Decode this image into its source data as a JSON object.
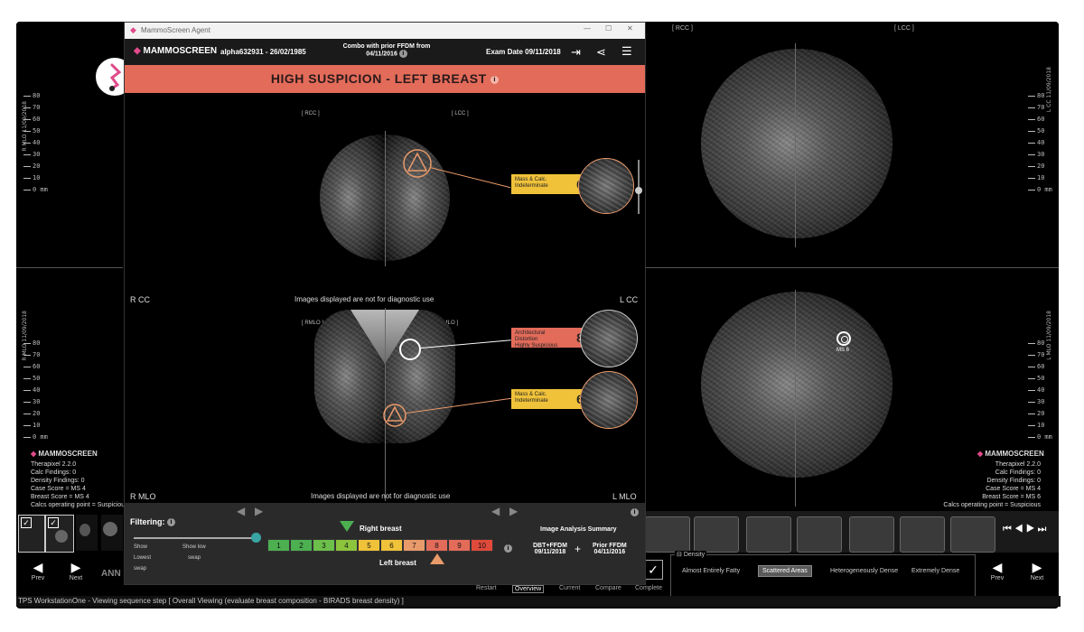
{
  "agent": {
    "window_title": "MammoScreen Agent",
    "logo": "MAMMOSCREEN",
    "patient": "alpha632931 - 26/02/1985",
    "combo_line1": "Combo with prior FFDM from",
    "combo_line2": "04/11/2016",
    "exam_date": "Exam Date 09/11/2018",
    "alert": "HIGH SUSPICION - LEFT BREAST",
    "view_rcc": "R CC",
    "view_lcc": "L CC",
    "view_rmlo": "R MLO",
    "view_lmlo": "L MLO",
    "not_diag_top": "Images displayed are not for diagnostic use",
    "not_diag_bottom": "Images displayed are not for diagnostic use",
    "findings": [
      {
        "label1": "Mass & Calc.",
        "label2": "Indeterminate",
        "score": "6",
        "color": "#f0c23a"
      },
      {
        "label1": "Architectural Distortion",
        "label2": "Highly Suspicious",
        "score": "8",
        "color": "#e36b5a"
      },
      {
        "label1": "Mass & Calc.",
        "label2": "Indeterminate",
        "score": "6",
        "color": "#f0c23a"
      }
    ]
  },
  "bottom": {
    "filtering": "Filtering:",
    "filter_show": "Show",
    "filter_show_low": "Show low",
    "filter_lowest": "Lowest",
    "filter_swap": "swap",
    "filter_swap2": "swap",
    "right_breast": "Right breast",
    "left_breast": "Left breast",
    "scale": [
      "1",
      "2",
      "3",
      "4",
      "5",
      "6",
      "7",
      "8",
      "9",
      "10"
    ],
    "summary_title": "Image Analysis Summary",
    "dbt_label": "DBT+FFDM",
    "dbt_date": "09/11/2018",
    "plus": "+",
    "prior_label": "Prior FFDM",
    "prior_date": "04/11/2016"
  },
  "workstation": {
    "overlay_lines": [
      "Therapixel 2.2.0",
      "Calc Findings: 0",
      "Density Findings: 0",
      "Case Score = MS 4",
      "Breast Score = MS 4",
      "Calcs operating point = Suspicious"
    ],
    "overlay_lines_right": [
      "Therapixel 2.2.0",
      "Calc Findings: 0",
      "Density Findings: 0",
      "Case Score = MS 4",
      "Breast Score = MS 6",
      "Calcs operating point = Suspicious"
    ],
    "ms6": "MS 6",
    "mammo_logo": "MAMMOSCREEN",
    "prev": "Prev",
    "next": "Next",
    "ann": "ANN",
    "tabs": [
      "Restart",
      "Overview",
      "Current",
      "Compare",
      "Complete"
    ],
    "density_title": "Density",
    "density_options": [
      "Almost Entirely Fatty",
      "Scattered Areas",
      "Heterogeneously Dense",
      "Extremely Dense"
    ],
    "density_selected": "Scattered Areas",
    "status": "TPS WorkstationOne - Viewing sequence step [ Overall Viewing (evaluate breast composition - BIRADS breast density) ]",
    "ruler_labels": [
      "80",
      "70",
      "60",
      "50",
      "40",
      "30",
      "20",
      "10",
      "0 mm"
    ]
  }
}
